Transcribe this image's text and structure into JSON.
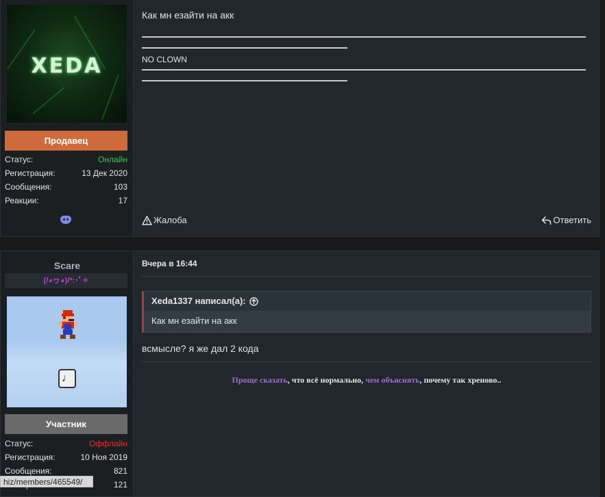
{
  "post1": {
    "avatar_logo": "XEDA",
    "role": "Продавец",
    "stats": [
      {
        "label": "Статус:",
        "value": "Онлайн"
      },
      {
        "label": "Регистрация:",
        "value": "13 Дек 2020"
      },
      {
        "label": "Сообщения:",
        "value": "103"
      },
      {
        "label": "Реакции:",
        "value": "17"
      }
    ],
    "discord_icon": "discord-icon",
    "message": "Как мн езайти на акк",
    "signature": "NO CLOWN",
    "report_label": "Жалоба",
    "reply_label": "Ответить"
  },
  "post2": {
    "username": "Scare",
    "user_title": "(/◕ヮ◕)/*:･ﾟ✧",
    "role": "Участник",
    "stats": [
      {
        "label": "Статус:",
        "value": "Оффлайн"
      },
      {
        "label": "Регистрация:",
        "value": "10 Ноя 2019"
      },
      {
        "label": "Сообщения:",
        "value": "821"
      },
      {
        "label": "Реакции:",
        "value": "121"
      }
    ],
    "date": "Вчера в 16:44",
    "quote_author": "Xeda1337 написал(а):",
    "quote_text": "Как мн езайти на акк",
    "message": "всмысле? я же дал 2 кода",
    "signature": {
      "part1": "Проще сказать",
      "part2": ", что всё нормально, ",
      "part3": "чем объяснять",
      "part4": ", почему так хреново.."
    }
  },
  "status_url": "hiz/members/465549/",
  "colors": {
    "online": "#3ec64a",
    "offline": "#e0302a",
    "seller": "#cf6b3a",
    "member": "#6a6a6a",
    "sig_purple": "#9b6fd6",
    "usertitle": "#c53cd8"
  }
}
